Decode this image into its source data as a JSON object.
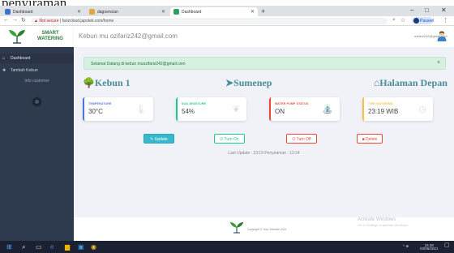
{
  "document_fragment": {
    "text": "penyiraman."
  },
  "browser": {
    "tabs": [
      {
        "label": "Dashboard",
        "active": false,
        "color": "#3b73c8"
      },
      {
        "label": "dagoencian",
        "active": false,
        "color": "#e8a33a"
      },
      {
        "label": "Dashboard",
        "active": true,
        "color": "#2f9e64"
      }
    ],
    "url": "farizcloud.japotek.com/home",
    "security_label": "Not secure",
    "profile_status": "Paused"
  },
  "sidebar": {
    "brand": [
      "SMART",
      "WATERING"
    ],
    "items": [
      {
        "label": "Dashboard",
        "icon": "home-icon"
      },
      {
        "label": "Tambah Kebun",
        "icon": "plus-icon"
      }
    ],
    "sub_label": "Info customer"
  },
  "topbar": {
    "title": "Kebun mu ozifariz242@gmail.com",
    "user": "ozfariz242@gmail.com"
  },
  "alert": {
    "text": "Selamat Datang di kebun muozifariz242@gmail.com",
    "close": "×"
  },
  "headings": {
    "garden": "Kebun 1",
    "location": "Sumenep",
    "home": "Halaman Depan"
  },
  "cards": [
    {
      "label": "TEMPERATURE",
      "value": "30°C",
      "color": "#4e73df",
      "icon": "thermometer-icon"
    },
    {
      "label": "SOIL MOISTURE",
      "value": "54%",
      "color": "#1cc88a",
      "icon": "plant-icon"
    },
    {
      "label": "WATER PUMP STATUS",
      "value": "ON",
      "color": "#e74a3b",
      "icon": "pump-icon"
    },
    {
      "label": "TIME WATERING",
      "value": "23:19 WIB",
      "color": "#f6c23e",
      "icon": "clock-icon"
    }
  ],
  "buttons": {
    "update": "Update",
    "on": "Turn On",
    "off": "Turn Off",
    "delete": "Delete"
  },
  "last_update": "Last Update : 23:19  Penyiraman : 12:24",
  "footer": {
    "text": "Copyright © Your Website 2021"
  },
  "watermark": {
    "title": "Activate Windows",
    "subtitle": "Go to Settings to activate Windows."
  },
  "taskbar": {
    "time": "15.38",
    "date": "03/06/2021"
  }
}
